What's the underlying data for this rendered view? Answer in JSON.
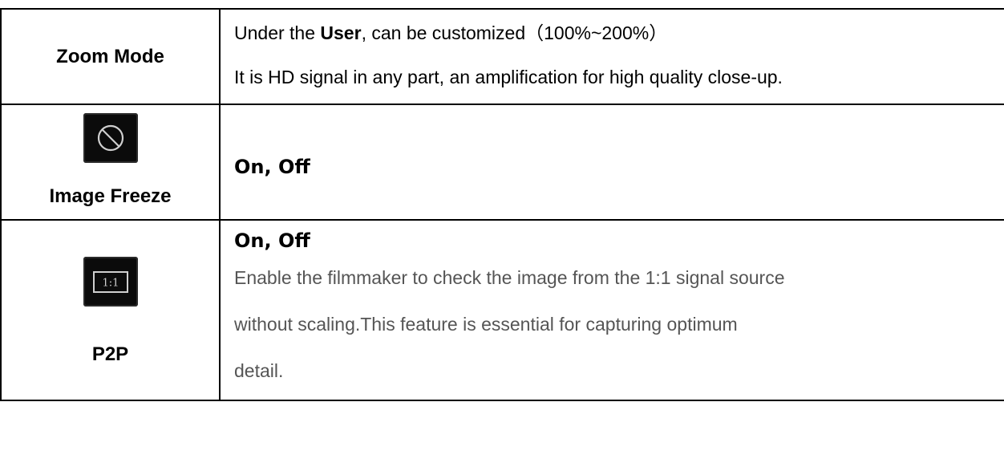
{
  "rows": [
    {
      "label": "Zoom Mode",
      "desc": {
        "prefix": "Under the ",
        "bold": "User",
        "suffix": ", can be customized（100%~200%）",
        "line2": "It is HD signal in any part, an amplification for high quality close-up."
      }
    },
    {
      "label": "Image Freeze",
      "icon": "prohibited-circle-icon",
      "options": "On, Off"
    },
    {
      "label": "P2P",
      "icon": "one-to-one-icon",
      "icon_text": "1:1",
      "options": "On, Off",
      "lines": [
        "Enable the filmmaker to check the image from the 1:1 signal source",
        "without scaling.This feature is essential for capturing optimum",
        "detail."
      ]
    }
  ],
  "colors": {
    "border": "#000000",
    "icon_bg": "#0b0b0b",
    "icon_stroke": "#cfcfcf",
    "gray_text": "#555555"
  }
}
